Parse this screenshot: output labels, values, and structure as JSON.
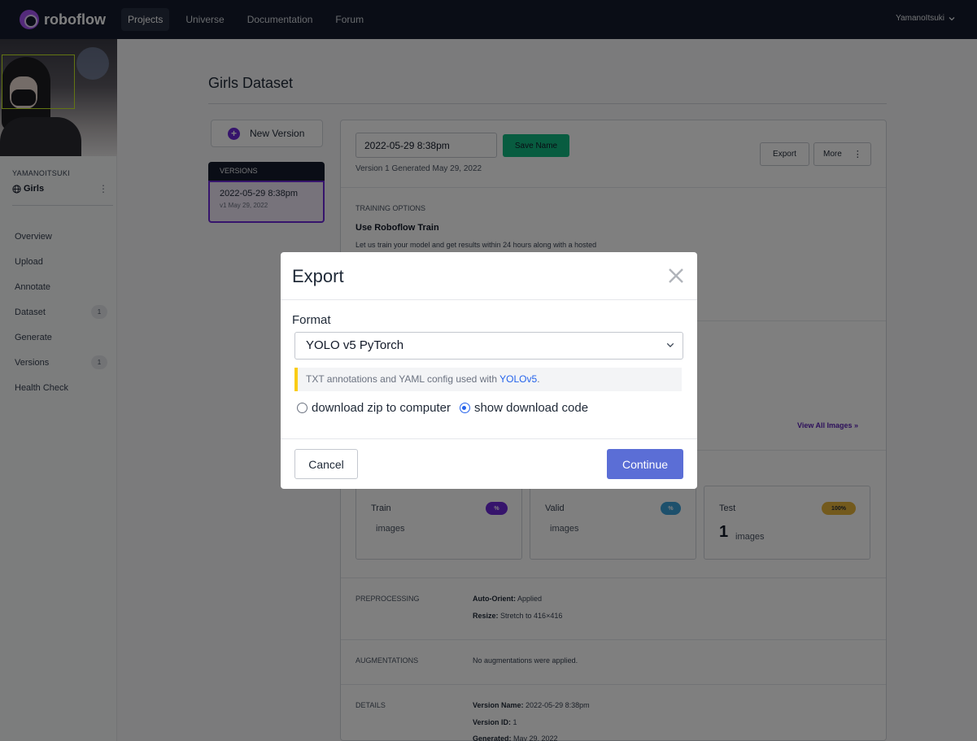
{
  "brand": {
    "name": "roboflow"
  },
  "nav": {
    "links": [
      {
        "label": "Projects"
      },
      {
        "label": "Universe"
      },
      {
        "label": "Documentation"
      },
      {
        "label": "Forum"
      }
    ],
    "user": "YamanoItsuki"
  },
  "sidebar": {
    "workspace": "YAMANOITSUKI",
    "project": "Girls",
    "items": [
      {
        "label": "Overview"
      },
      {
        "label": "Upload"
      },
      {
        "label": "Annotate"
      },
      {
        "label": "Dataset",
        "badge": "1"
      },
      {
        "label": "Generate"
      },
      {
        "label": "Versions",
        "badge": "1"
      },
      {
        "label": "Health Check"
      }
    ]
  },
  "page": {
    "title": "Girls Dataset"
  },
  "versions": {
    "new_label": "New Version",
    "header": "VERSIONS",
    "items": [
      {
        "name": "2022-05-29 8:38pm",
        "sub": "v1 May 29, 2022"
      }
    ]
  },
  "detail": {
    "name_value": "2022-05-29 8:38pm",
    "save_label": "Save Name",
    "generated": "Version 1 Generated May 29, 2022",
    "export_label": "Export",
    "more_label": "More",
    "training_label": "TRAINING OPTIONS",
    "training_title": "Use Roboflow Train",
    "training_desc": "Let us train your model and get results within 24 hours along with a hosted",
    "view_all": "View All Images",
    "splits": [
      {
        "name": "Train",
        "pill": "%",
        "count": "",
        "images": "images",
        "pill_color": "#6d28d9",
        "pill_text_color": "#ffffff"
      },
      {
        "name": "Valid",
        "pill": "%",
        "count": "",
        "images": "images",
        "pill_color": "#3aa0d9",
        "pill_text_color": "#ffffff"
      },
      {
        "name": "Test",
        "pill": "100%",
        "count": "1",
        "images": "images",
        "pill_color": "#e7b53a",
        "pill_text_color": "#1f2937"
      }
    ],
    "preprocessing_label": "PREPROCESSING",
    "preprocessing": [
      {
        "key": "Auto-Orient:",
        "value": "Applied"
      },
      {
        "key": "Resize:",
        "value": "Stretch to 416×416"
      }
    ],
    "augmentations_label": "AUGMENTATIONS",
    "augmentations_value": "No augmentations were applied.",
    "details_label": "DETAILS",
    "details": [
      {
        "key": "Version Name:",
        "value": "2022-05-29 8:38pm"
      },
      {
        "key": "Version ID:",
        "value": "1"
      },
      {
        "key": "Generated:",
        "value": "May 29, 2022"
      }
    ]
  },
  "modal": {
    "title": "Export",
    "format_label": "Format",
    "format_value": "YOLO v5 PyTorch",
    "hint_prefix": "TXT annotations and YAML config used with ",
    "hint_link": "YOLOv5",
    "hint_suffix": ".",
    "radio_zip": "download zip to computer",
    "radio_code": "show download code",
    "selected_option": "show download code",
    "cancel_label": "Cancel",
    "continue_label": "Continue"
  },
  "colors": {
    "nav_bg": "#141b2d",
    "accent_purple": "#6d28d9",
    "save_green": "#10b981",
    "continue_blue": "#5b6ed6",
    "hint_yellow": "#facc15"
  },
  "icons": [
    "logo-icon",
    "chevron-down-icon",
    "globe-icon",
    "more-vertical-icon",
    "plus-circle-icon",
    "close-icon",
    "double-chevron-right-icon"
  ]
}
